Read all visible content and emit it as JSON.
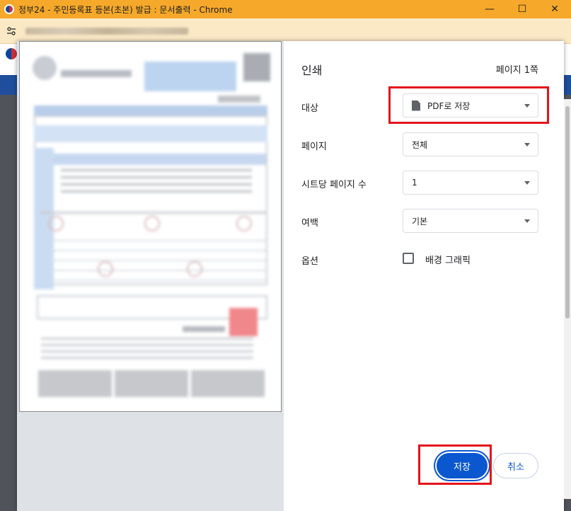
{
  "window": {
    "title": "정부24 - 주민등록표 등본(초본) 발급 : 문서출력 - Chrome",
    "minimize_glyph": "—",
    "maximize_glyph": "☐",
    "close_glyph": "✕"
  },
  "address_bar": {
    "site_info_icon": "tune-icon"
  },
  "print_dialog": {
    "title": "인쇄",
    "page_count": "페이지 1쪽",
    "destination": {
      "label": "대상",
      "value": "PDF로 저장"
    },
    "pages": {
      "label": "페이지",
      "value": "전체"
    },
    "pages_per_sheet": {
      "label": "시트당 페이지 수",
      "value": "1"
    },
    "margins": {
      "label": "여백",
      "value": "기본"
    },
    "options": {
      "label": "옵션",
      "checkbox_label": "배경 그래픽",
      "checked": false
    },
    "save_button": "저장",
    "cancel_button": "취소"
  },
  "colors": {
    "titlebar": "#f5a829",
    "addressbar": "#fbe9c6",
    "primary_button": "#0b57d0",
    "highlight": "#e3141b"
  }
}
